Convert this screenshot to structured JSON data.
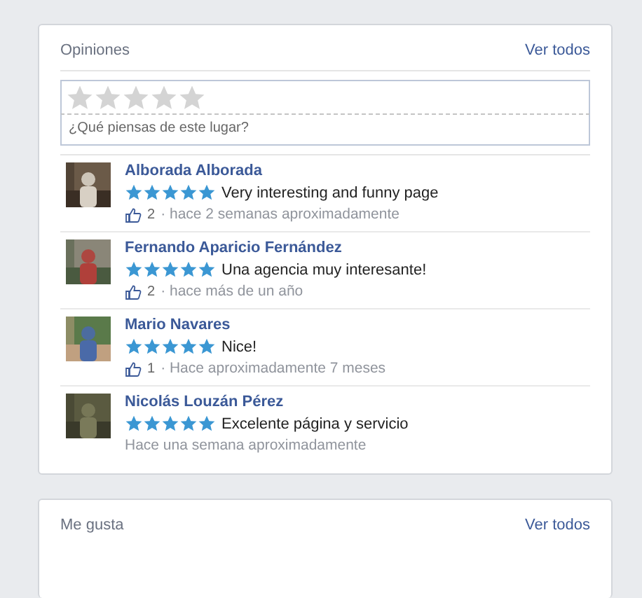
{
  "reviews_card": {
    "title": "Opiniones",
    "see_all": "Ver todos",
    "rating_input": {
      "stars": 0,
      "placeholder": "¿Qué piensas de este lugar?"
    },
    "reviews": [
      {
        "name": "Alborada Alborada",
        "stars": 5,
        "text": "Very interesting and funny page",
        "likes": "2",
        "time": "· hace 2 semanas aproximadamente"
      },
      {
        "name": "Fernando Aparicio Fernández",
        "stars": 5,
        "text": "Una agencia muy interesante!",
        "likes": "2",
        "time": "· hace más de un año"
      },
      {
        "name": "Mario Navares",
        "stars": 5,
        "text": "Nice!",
        "likes": "1",
        "time": "· Hace aproximadamente 7 meses"
      },
      {
        "name": "Nicolás Louzán Pérez",
        "stars": 5,
        "text": "Excelente página y servicio",
        "time": "Hace una semana aproximadamente"
      }
    ]
  },
  "likes_card": {
    "title": "Me gusta",
    "see_all": "Ver todos"
  }
}
